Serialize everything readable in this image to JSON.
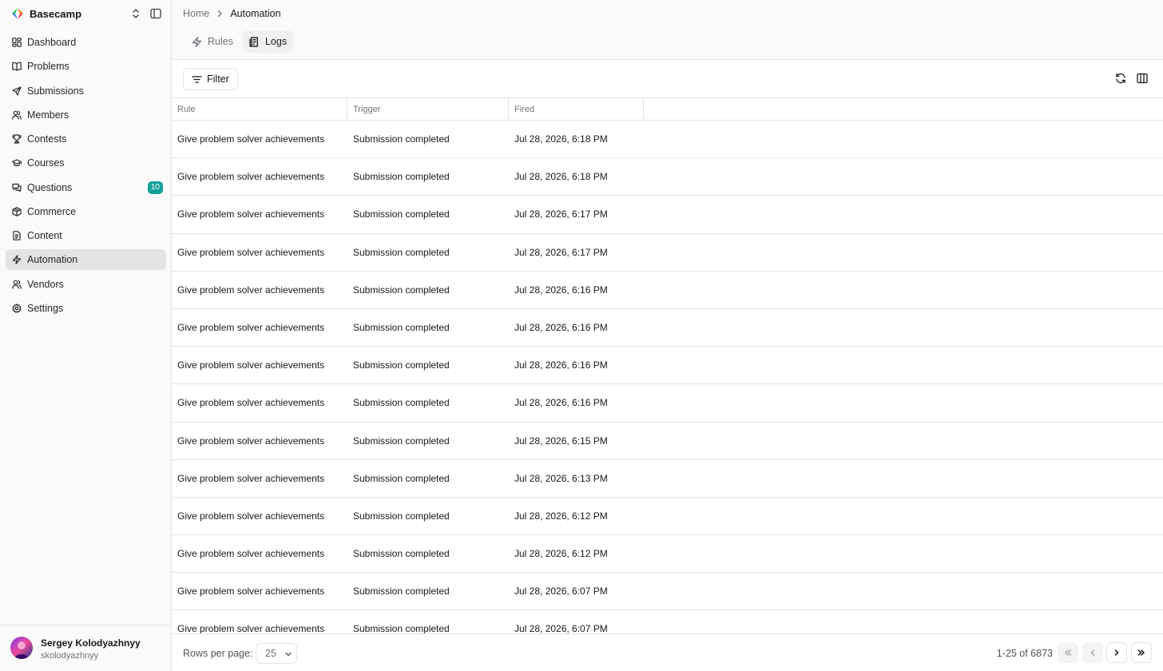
{
  "sidebar": {
    "brand": "Basecamp",
    "items": [
      {
        "label": "Dashboard",
        "icon": "dashboard-icon"
      },
      {
        "label": "Problems",
        "icon": "book-icon"
      },
      {
        "label": "Submissions",
        "icon": "send-icon"
      },
      {
        "label": "Members",
        "icon": "users-icon"
      },
      {
        "label": "Contests",
        "icon": "trophy-icon"
      },
      {
        "label": "Courses",
        "icon": "graduation-cap-icon"
      },
      {
        "label": "Questions",
        "icon": "chat-icon",
        "badge": "10"
      },
      {
        "label": "Commerce",
        "icon": "package-icon"
      },
      {
        "label": "Content",
        "icon": "document-icon"
      },
      {
        "label": "Automation",
        "icon": "zap-icon",
        "active": true
      },
      {
        "label": "Vendors",
        "icon": "users-icon"
      },
      {
        "label": "Settings",
        "icon": "gear-icon"
      }
    ],
    "user": {
      "name": "Sergey Kolodyazhnyy",
      "handle": "skolodyazhnyy"
    }
  },
  "breadcrumb": {
    "home": "Home",
    "current": "Automation"
  },
  "tabs": [
    {
      "label": "Rules",
      "icon": "zap-icon"
    },
    {
      "label": "Logs",
      "icon": "logs-icon",
      "active": true
    }
  ],
  "toolbar": {
    "filter_label": "Filter"
  },
  "table": {
    "columns": [
      "Rule",
      "Trigger",
      "Fired"
    ],
    "rows": [
      [
        "Give problem solver achievements",
        "Submission completed",
        "Jul 28, 2026, 6:18 PM"
      ],
      [
        "Give problem solver achievements",
        "Submission completed",
        "Jul 28, 2026, 6:18 PM"
      ],
      [
        "Give problem solver achievements",
        "Submission completed",
        "Jul 28, 2026, 6:17 PM"
      ],
      [
        "Give problem solver achievements",
        "Submission completed",
        "Jul 28, 2026, 6:17 PM"
      ],
      [
        "Give problem solver achievements",
        "Submission completed",
        "Jul 28, 2026, 6:16 PM"
      ],
      [
        "Give problem solver achievements",
        "Submission completed",
        "Jul 28, 2026, 6:16 PM"
      ],
      [
        "Give problem solver achievements",
        "Submission completed",
        "Jul 28, 2026, 6:16 PM"
      ],
      [
        "Give problem solver achievements",
        "Submission completed",
        "Jul 28, 2026, 6:16 PM"
      ],
      [
        "Give problem solver achievements",
        "Submission completed",
        "Jul 28, 2026, 6:15 PM"
      ],
      [
        "Give problem solver achievements",
        "Submission completed",
        "Jul 28, 2026, 6:13 PM"
      ],
      [
        "Give problem solver achievements",
        "Submission completed",
        "Jul 28, 2026, 6:12 PM"
      ],
      [
        "Give problem solver achievements",
        "Submission completed",
        "Jul 28, 2026, 6:12 PM"
      ],
      [
        "Give problem solver achievements",
        "Submission completed",
        "Jul 28, 2026, 6:07 PM"
      ],
      [
        "Give problem solver achievements",
        "Submission completed",
        "Jul 28, 2026, 6:07 PM"
      ]
    ]
  },
  "footer": {
    "rows_per_page_label": "Rows per page:",
    "rows_per_page": "25",
    "page_range": "1-25 of 6873"
  },
  "colors": {
    "accent_badge": "#14a099",
    "active_nav": "#e4e4e7",
    "border": "#e4e4e7"
  }
}
